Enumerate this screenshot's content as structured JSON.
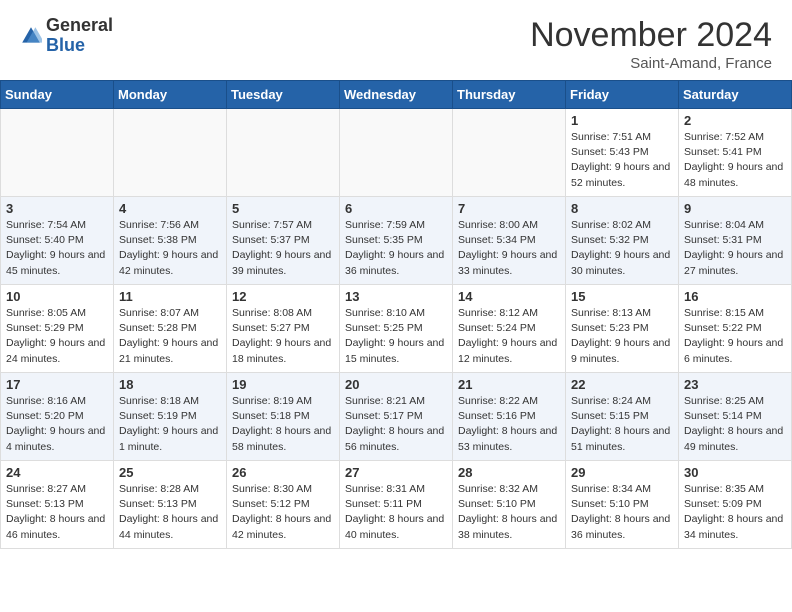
{
  "header": {
    "logo_general": "General",
    "logo_blue": "Blue",
    "month": "November 2024",
    "location": "Saint-Amand, France"
  },
  "weekdays": [
    "Sunday",
    "Monday",
    "Tuesday",
    "Wednesday",
    "Thursday",
    "Friday",
    "Saturday"
  ],
  "weeks": [
    [
      {
        "num": "",
        "empty": true
      },
      {
        "num": "",
        "empty": true
      },
      {
        "num": "",
        "empty": true
      },
      {
        "num": "",
        "empty": true
      },
      {
        "num": "",
        "empty": true
      },
      {
        "num": "1",
        "sunrise": "7:51 AM",
        "sunset": "5:43 PM",
        "daylight": "9 hours and 52 minutes."
      },
      {
        "num": "2",
        "sunrise": "7:52 AM",
        "sunset": "5:41 PM",
        "daylight": "9 hours and 48 minutes."
      }
    ],
    [
      {
        "num": "3",
        "sunrise": "7:54 AM",
        "sunset": "5:40 PM",
        "daylight": "9 hours and 45 minutes."
      },
      {
        "num": "4",
        "sunrise": "7:56 AM",
        "sunset": "5:38 PM",
        "daylight": "9 hours and 42 minutes."
      },
      {
        "num": "5",
        "sunrise": "7:57 AM",
        "sunset": "5:37 PM",
        "daylight": "9 hours and 39 minutes."
      },
      {
        "num": "6",
        "sunrise": "7:59 AM",
        "sunset": "5:35 PM",
        "daylight": "9 hours and 36 minutes."
      },
      {
        "num": "7",
        "sunrise": "8:00 AM",
        "sunset": "5:34 PM",
        "daylight": "9 hours and 33 minutes."
      },
      {
        "num": "8",
        "sunrise": "8:02 AM",
        "sunset": "5:32 PM",
        "daylight": "9 hours and 30 minutes."
      },
      {
        "num": "9",
        "sunrise": "8:04 AM",
        "sunset": "5:31 PM",
        "daylight": "9 hours and 27 minutes."
      }
    ],
    [
      {
        "num": "10",
        "sunrise": "8:05 AM",
        "sunset": "5:29 PM",
        "daylight": "9 hours and 24 minutes."
      },
      {
        "num": "11",
        "sunrise": "8:07 AM",
        "sunset": "5:28 PM",
        "daylight": "9 hours and 21 minutes."
      },
      {
        "num": "12",
        "sunrise": "8:08 AM",
        "sunset": "5:27 PM",
        "daylight": "9 hours and 18 minutes."
      },
      {
        "num": "13",
        "sunrise": "8:10 AM",
        "sunset": "5:25 PM",
        "daylight": "9 hours and 15 minutes."
      },
      {
        "num": "14",
        "sunrise": "8:12 AM",
        "sunset": "5:24 PM",
        "daylight": "9 hours and 12 minutes."
      },
      {
        "num": "15",
        "sunrise": "8:13 AM",
        "sunset": "5:23 PM",
        "daylight": "9 hours and 9 minutes."
      },
      {
        "num": "16",
        "sunrise": "8:15 AM",
        "sunset": "5:22 PM",
        "daylight": "9 hours and 6 minutes."
      }
    ],
    [
      {
        "num": "17",
        "sunrise": "8:16 AM",
        "sunset": "5:20 PM",
        "daylight": "9 hours and 4 minutes."
      },
      {
        "num": "18",
        "sunrise": "8:18 AM",
        "sunset": "5:19 PM",
        "daylight": "9 hours and 1 minute."
      },
      {
        "num": "19",
        "sunrise": "8:19 AM",
        "sunset": "5:18 PM",
        "daylight": "8 hours and 58 minutes."
      },
      {
        "num": "20",
        "sunrise": "8:21 AM",
        "sunset": "5:17 PM",
        "daylight": "8 hours and 56 minutes."
      },
      {
        "num": "21",
        "sunrise": "8:22 AM",
        "sunset": "5:16 PM",
        "daylight": "8 hours and 53 minutes."
      },
      {
        "num": "22",
        "sunrise": "8:24 AM",
        "sunset": "5:15 PM",
        "daylight": "8 hours and 51 minutes."
      },
      {
        "num": "23",
        "sunrise": "8:25 AM",
        "sunset": "5:14 PM",
        "daylight": "8 hours and 49 minutes."
      }
    ],
    [
      {
        "num": "24",
        "sunrise": "8:27 AM",
        "sunset": "5:13 PM",
        "daylight": "8 hours and 46 minutes."
      },
      {
        "num": "25",
        "sunrise": "8:28 AM",
        "sunset": "5:13 PM",
        "daylight": "8 hours and 44 minutes."
      },
      {
        "num": "26",
        "sunrise": "8:30 AM",
        "sunset": "5:12 PM",
        "daylight": "8 hours and 42 minutes."
      },
      {
        "num": "27",
        "sunrise": "8:31 AM",
        "sunset": "5:11 PM",
        "daylight": "8 hours and 40 minutes."
      },
      {
        "num": "28",
        "sunrise": "8:32 AM",
        "sunset": "5:10 PM",
        "daylight": "8 hours and 38 minutes."
      },
      {
        "num": "29",
        "sunrise": "8:34 AM",
        "sunset": "5:10 PM",
        "daylight": "8 hours and 36 minutes."
      },
      {
        "num": "30",
        "sunrise": "8:35 AM",
        "sunset": "5:09 PM",
        "daylight": "8 hours and 34 minutes."
      }
    ]
  ]
}
